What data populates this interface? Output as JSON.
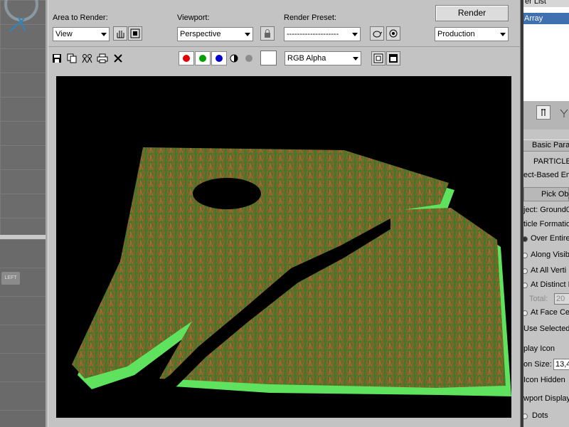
{
  "toolbar": {
    "area_to_render_label": "Area to Render:",
    "area_to_render_value": "View",
    "viewport_label": "Viewport:",
    "viewport_value": "Perspective",
    "render_preset_label": "Render Preset:",
    "render_preset_value": "--------------------",
    "render_button": "Render",
    "production_value": "Production",
    "channel_value": "RGB Alpha"
  },
  "left_viewport": {
    "label": "LEFT"
  },
  "right_panel": {
    "list_title": "er List",
    "list_selected": "Array",
    "rollout_basic": "Basic Para",
    "particle_title": "PARTICLE",
    "object_based": "ect-Based Em",
    "pick_object": "Pick Obj",
    "object_name": "ject: Ground0",
    "particle_formation": "ticle Formatio",
    "opt_over_entire": "Over Entire",
    "opt_along_visible": "Along Visibl",
    "opt_all_vertices": "At All Verti",
    "opt_distinct": "At Distinct P",
    "total_label": "Total:",
    "total_value": "20",
    "opt_face_centers": "At Face Cer",
    "opt_use_selected": "Use Selected",
    "display_icon": "play Icon",
    "icon_size_label": "on Size:",
    "icon_size_value": "13,4",
    "icon_hidden": "Icon Hidden",
    "viewport_display": "wport Display",
    "dots": "Dots"
  },
  "colors": {
    "viewport_bg": "#000000",
    "grass_green": "#5fe35f",
    "grass_brown": "#a5582a",
    "accent_red": "#e00000",
    "accent_green": "#00a000",
    "accent_blue": "#0000d0"
  }
}
